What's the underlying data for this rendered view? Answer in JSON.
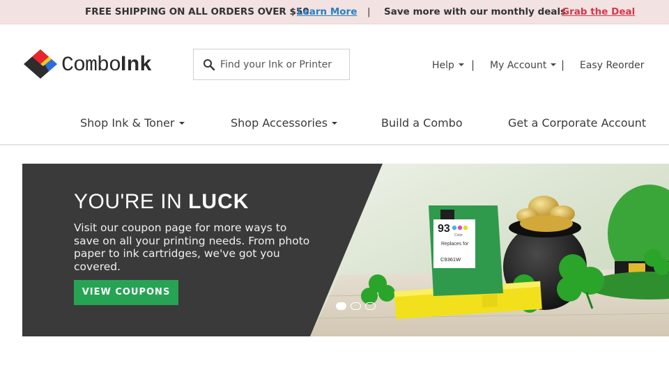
{
  "promo": {
    "shipping_text": "FREE SHIPPING ON ALL ORDERS OVER $50",
    "learn_more": "Learn More",
    "separator": "|",
    "deals_text": "Save more with our monthly deals",
    "grab_deal": "Grab the Deal"
  },
  "header": {
    "logo": {
      "part1": "Combo",
      "part2": "Ink"
    },
    "search": {
      "placeholder": "Find your Ink or Printer",
      "value": ""
    },
    "utility_links": [
      {
        "label": "Help",
        "has_dropdown": true
      },
      {
        "label": "My Account",
        "has_dropdown": true
      },
      {
        "label": "Easy Reorder",
        "has_dropdown": false
      }
    ],
    "pipe": "|"
  },
  "nav": {
    "items": [
      {
        "label": "Shop Ink & Toner",
        "has_dropdown": true
      },
      {
        "label": "Shop Accessories",
        "has_dropdown": true
      },
      {
        "label": "Build a Combo",
        "has_dropdown": false
      },
      {
        "label": "Get a Corporate Account",
        "has_dropdown": false
      }
    ]
  },
  "hero": {
    "heading_light": "YOU'RE IN ",
    "heading_bold": "LUCK",
    "body": "Visit our coupon page for more ways to save on all your printing needs. From photo paper to ink cartridges, we've got you covered.",
    "cta_label": "VIEW COUPONS",
    "cartridge": {
      "number": "93",
      "sub": "Color",
      "replaces": "Replaces for",
      "model": "C9361W"
    },
    "slides_total": 3,
    "active_slide": 1
  },
  "colors": {
    "promo_bg": "#f2e2e2",
    "learn_link": "#2a7fc1",
    "grab_link": "#d8364a",
    "hero_dark": "#3b3a3b",
    "cta_green": "#27a354"
  }
}
